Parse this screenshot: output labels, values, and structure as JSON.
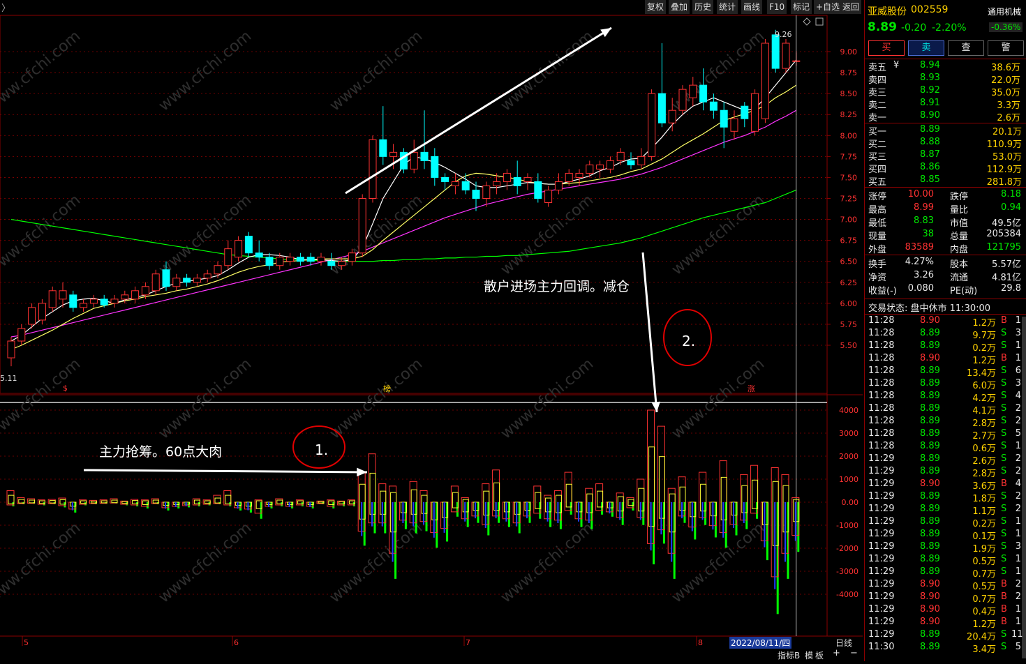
{
  "toolbar": {
    "back_arrow": "〉",
    "items": [
      "复权",
      "叠加",
      "历史",
      "统计",
      "画线",
      "F10",
      "标记",
      "+自选",
      "返回"
    ]
  },
  "price_axis": {
    "labels": [
      "9.00",
      "8.75",
      "8.50",
      "8.25",
      "8.00",
      "7.75",
      "7.50",
      "7.25",
      "7.00",
      "6.75",
      "6.50",
      "6.25",
      "6.00",
      "5.75",
      "5.50"
    ],
    "high_label": "9.26",
    "low_label": "5.11"
  },
  "volume_axis": {
    "labels": [
      "4000",
      "3000",
      "2000",
      "1000",
      "0.00",
      "-1000",
      "-2000",
      "-3000",
      "-4000"
    ]
  },
  "date_axis": {
    "labels": [
      "5",
      "6",
      "7",
      "8"
    ],
    "current_date": "2022/08/11/四",
    "period": "日线"
  },
  "markers": {
    "m1": "$",
    "m2": "榜",
    "m3": "涨"
  },
  "annotations": {
    "text_top": "散户进场主力回调。减仓",
    "text_bottom": "主力抢筹。60点大肉",
    "circle1": "1.",
    "circle2": "2."
  },
  "bottom_bar": {
    "indicator": "指标B",
    "template": "模",
    "board": "板",
    "plus": "+",
    "minus": "−"
  },
  "watermark": "www.cfchi.com",
  "stock": {
    "name": "亚威股份",
    "code": "002559",
    "sector": "通用机械",
    "sector_change": "-0.36%",
    "price": "8.89",
    "change": "-0.20",
    "change_pct": "-2.20%"
  },
  "trade_buttons": [
    "买",
    "卖",
    "查",
    "警"
  ],
  "order_book": {
    "asks": [
      {
        "label": "卖五",
        "price": "8.94",
        "vol": "38.6万",
        "mark": "¥"
      },
      {
        "label": "卖四",
        "price": "8.93",
        "vol": "22.0万",
        "mark": ""
      },
      {
        "label": "卖三",
        "price": "8.92",
        "vol": "35.0万",
        "mark": ""
      },
      {
        "label": "卖二",
        "price": "8.91",
        "vol": "3.3万",
        "mark": ""
      },
      {
        "label": "卖一",
        "price": "8.90",
        "vol": "2.6万",
        "mark": ""
      }
    ],
    "bids": [
      {
        "label": "买一",
        "price": "8.89",
        "vol": "20.1万"
      },
      {
        "label": "买二",
        "price": "8.88",
        "vol": "110.9万"
      },
      {
        "label": "买三",
        "price": "8.87",
        "vol": "53.0万"
      },
      {
        "label": "买四",
        "price": "8.86",
        "vol": "112.9万"
      },
      {
        "label": "买五",
        "price": "8.85",
        "vol": "281.8万"
      }
    ]
  },
  "stats": [
    {
      "l1": "涨停",
      "v1": "10.00",
      "c1": "red",
      "l2": "跌停",
      "v2": "8.18",
      "c2": "green"
    },
    {
      "l1": "最高",
      "v1": "8.99",
      "c1": "red",
      "l2": "量比",
      "v2": "0.94",
      "c2": "green"
    },
    {
      "l1": "最低",
      "v1": "8.83",
      "c1": "green",
      "l2": "市值",
      "v2": "49.5亿",
      "c2": "white"
    },
    {
      "l1": "现量",
      "v1": "38",
      "c1": "green",
      "l2": "总量",
      "v2": "205384",
      "c2": "white"
    },
    {
      "l1": "外盘",
      "v1": "83589",
      "c1": "red",
      "l2": "内盘",
      "v2": "121795",
      "c2": "green"
    }
  ],
  "stats2": [
    {
      "l1": "换手",
      "v1": "4.27%",
      "l2": "股本",
      "v2": "5.57亿"
    },
    {
      "l1": "净资",
      "v1": "3.26",
      "l2": "流通",
      "v2": "4.81亿"
    },
    {
      "l1": "收益(-)",
      "v1": "0.080",
      "l2": "PE(动)",
      "v2": "29.8"
    }
  ],
  "trade_status": "交易状态: 盘中休市 11:30:00",
  "ticks": [
    {
      "t": "11:28",
      "p": "8.90",
      "v": "1.2万",
      "d": "B",
      "n": "1"
    },
    {
      "t": "11:28",
      "p": "8.89",
      "v": "9.7万",
      "d": "S",
      "n": "3"
    },
    {
      "t": "11:28",
      "p": "8.89",
      "v": "0.2万",
      "d": "S",
      "n": "1"
    },
    {
      "t": "11:28",
      "p": "8.90",
      "v": "1.2万",
      "d": "B",
      "n": "1"
    },
    {
      "t": "11:28",
      "p": "8.89",
      "v": "13.4万",
      "d": "S",
      "n": "6"
    },
    {
      "t": "11:28",
      "p": "8.89",
      "v": "6.0万",
      "d": "S",
      "n": "3"
    },
    {
      "t": "11:28",
      "p": "8.89",
      "v": "4.2万",
      "d": "S",
      "n": "4"
    },
    {
      "t": "11:28",
      "p": "8.89",
      "v": "4.1万",
      "d": "S",
      "n": "2"
    },
    {
      "t": "11:28",
      "p": "8.89",
      "v": "2.8万",
      "d": "S",
      "n": "2"
    },
    {
      "t": "11:28",
      "p": "8.89",
      "v": "2.7万",
      "d": "S",
      "n": "5"
    },
    {
      "t": "11:28",
      "p": "8.89",
      "v": "0.6万",
      "d": "S",
      "n": "1"
    },
    {
      "t": "11:29",
      "p": "8.89",
      "v": "2.6万",
      "d": "S",
      "n": "2"
    },
    {
      "t": "11:29",
      "p": "8.89",
      "v": "2.8万",
      "d": "S",
      "n": "2"
    },
    {
      "t": "11:29",
      "p": "8.90",
      "v": "3.6万",
      "d": "B",
      "n": "4"
    },
    {
      "t": "11:29",
      "p": "8.89",
      "v": "1.8万",
      "d": "S",
      "n": "2"
    },
    {
      "t": "11:29",
      "p": "8.89",
      "v": "1.1万",
      "d": "S",
      "n": "2"
    },
    {
      "t": "11:29",
      "p": "8.89",
      "v": "0.2万",
      "d": "S",
      "n": "1"
    },
    {
      "t": "11:29",
      "p": "8.89",
      "v": "0.1万",
      "d": "S",
      "n": "1"
    },
    {
      "t": "11:29",
      "p": "8.89",
      "v": "1.9万",
      "d": "S",
      "n": "3"
    },
    {
      "t": "11:29",
      "p": "8.89",
      "v": "0.5万",
      "d": "S",
      "n": "1"
    },
    {
      "t": "11:29",
      "p": "8.89",
      "v": "0.7万",
      "d": "S",
      "n": "1"
    },
    {
      "t": "11:29",
      "p": "8.90",
      "v": "0.5万",
      "d": "B",
      "n": "2"
    },
    {
      "t": "11:29",
      "p": "8.90",
      "v": "0.7万",
      "d": "B",
      "n": "2"
    },
    {
      "t": "11:29",
      "p": "8.90",
      "v": "0.4万",
      "d": "B",
      "n": "1"
    },
    {
      "t": "11:29",
      "p": "8.90",
      "v": "1.2万",
      "d": "B",
      "n": "1"
    },
    {
      "t": "11:29",
      "p": "8.89",
      "v": "20.4万",
      "d": "S",
      "n": "11"
    },
    {
      "t": "11:30",
      "p": "8.89",
      "v": "3.4万",
      "d": "S",
      "n": "5"
    }
  ],
  "colors": {
    "up": "#ff3232",
    "down": "#00ffff",
    "ma5": "#ffffff",
    "ma10": "#ffff66",
    "ma20": "#ff33ff",
    "ma60": "#00ff00"
  },
  "chart_data": {
    "type": "candlestick",
    "price_range": [
      5.11,
      9.26
    ],
    "candles": [
      [
        5.35,
        5.55,
        5.25,
        5.6
      ],
      [
        5.55,
        5.7,
        5.5,
        5.75
      ],
      [
        5.75,
        5.95,
        5.7,
        6.0
      ],
      [
        5.8,
        6.0,
        5.75,
        6.05
      ],
      [
        5.95,
        6.15,
        5.9,
        6.2
      ],
      [
        6.05,
        6.15,
        5.95,
        6.25
      ],
      [
        6.1,
        5.95,
        5.9,
        6.15
      ],
      [
        5.95,
        6.0,
        5.9,
        6.05
      ],
      [
        6.0,
        6.05,
        5.95,
        6.1
      ],
      [
        6.05,
        5.98,
        5.95,
        6.1
      ],
      [
        6.0,
        6.05,
        5.95,
        6.1
      ],
      [
        6.05,
        6.1,
        6.0,
        6.15
      ],
      [
        6.05,
        6.15,
        6.0,
        6.2
      ],
      [
        6.1,
        6.2,
        6.05,
        6.25
      ],
      [
        6.15,
        6.35,
        6.1,
        6.4
      ],
      [
        6.4,
        6.2,
        6.15,
        6.5
      ],
      [
        6.2,
        6.3,
        6.15,
        6.35
      ],
      [
        6.3,
        6.25,
        6.2,
        6.35
      ],
      [
        6.25,
        6.3,
        6.2,
        6.35
      ],
      [
        6.3,
        6.35,
        6.25,
        6.4
      ],
      [
        6.35,
        6.45,
        6.3,
        6.5
      ],
      [
        6.45,
        6.65,
        6.4,
        6.75
      ],
      [
        6.55,
        6.75,
        6.5,
        6.8
      ],
      [
        6.8,
        6.6,
        6.55,
        6.85
      ],
      [
        6.6,
        6.55,
        6.5,
        6.75
      ],
      [
        6.55,
        6.45,
        6.4,
        6.6
      ],
      [
        6.45,
        6.55,
        6.4,
        6.6
      ],
      [
        6.5,
        6.55,
        6.45,
        6.6
      ],
      [
        6.55,
        6.5,
        6.45,
        6.6
      ],
      [
        6.55,
        6.5,
        6.45,
        6.6
      ],
      [
        6.5,
        6.55,
        6.45,
        6.6
      ],
      [
        6.5,
        6.45,
        6.4,
        6.6
      ],
      [
        6.45,
        6.5,
        6.4,
        6.55
      ],
      [
        6.5,
        6.6,
        6.45,
        6.65
      ],
      [
        6.6,
        7.25,
        6.55,
        7.3
      ],
      [
        7.25,
        7.95,
        7.2,
        8.0
      ],
      [
        7.95,
        7.75,
        7.65,
        8.35
      ],
      [
        7.75,
        7.8,
        7.6,
        7.9
      ],
      [
        7.8,
        7.6,
        7.55,
        7.85
      ],
      [
        7.6,
        7.8,
        7.55,
        7.95
      ],
      [
        7.8,
        7.7,
        7.6,
        8.3
      ],
      [
        7.75,
        7.5,
        7.4,
        7.85
      ],
      [
        7.5,
        7.45,
        7.35,
        7.55
      ],
      [
        7.4,
        7.45,
        7.3,
        7.55
      ],
      [
        7.45,
        7.35,
        7.3,
        7.55
      ],
      [
        7.35,
        7.25,
        7.1,
        7.45
      ],
      [
        7.25,
        7.4,
        7.15,
        7.45
      ],
      [
        7.4,
        7.45,
        7.3,
        7.55
      ],
      [
        7.45,
        7.55,
        7.35,
        7.6
      ],
      [
        7.5,
        7.4,
        7.3,
        7.7
      ],
      [
        7.45,
        7.5,
        7.35,
        7.55
      ],
      [
        7.45,
        7.25,
        7.2,
        7.55
      ],
      [
        7.2,
        7.35,
        7.15,
        7.4
      ],
      [
        7.35,
        7.45,
        7.3,
        7.55
      ],
      [
        7.45,
        7.55,
        7.4,
        7.6
      ],
      [
        7.5,
        7.55,
        7.4,
        7.6
      ],
      [
        7.55,
        7.65,
        7.5,
        7.7
      ],
      [
        7.6,
        7.65,
        7.5,
        7.7
      ],
      [
        7.6,
        7.7,
        7.55,
        7.75
      ],
      [
        7.7,
        7.8,
        7.65,
        7.85
      ],
      [
        7.7,
        7.65,
        7.6,
        7.8
      ],
      [
        7.65,
        7.75,
        7.6,
        7.85
      ],
      [
        7.75,
        8.5,
        7.7,
        8.55
      ],
      [
        8.5,
        8.15,
        8.1,
        9.1
      ],
      [
        8.15,
        8.3,
        8.05,
        8.45
      ],
      [
        8.3,
        8.55,
        8.25,
        8.6
      ],
      [
        8.45,
        8.6,
        8.35,
        8.7
      ],
      [
        8.6,
        8.4,
        8.3,
        8.8
      ],
      [
        8.4,
        8.3,
        8.2,
        8.5
      ],
      [
        8.3,
        8.1,
        7.85,
        8.4
      ],
      [
        8.05,
        8.2,
        7.95,
        8.3
      ],
      [
        8.35,
        8.2,
        8.1,
        8.4
      ],
      [
        8.05,
        8.5,
        8.0,
        8.55
      ],
      [
        8.2,
        9.1,
        8.15,
        9.15
      ],
      [
        9.2,
        8.8,
        8.75,
        9.26
      ],
      [
        8.8,
        9.1,
        8.75,
        9.15
      ],
      [
        8.89,
        8.89,
        8.83,
        8.99
      ]
    ],
    "ma5": [
      5.55,
      5.62,
      5.72,
      5.82,
      5.9,
      5.98,
      6.03,
      6.05,
      6.06,
      6.03,
      6.0,
      6.04,
      6.07,
      6.1,
      6.15,
      6.2,
      6.24,
      6.26,
      6.28,
      6.3,
      6.33,
      6.4,
      6.48,
      6.55,
      6.58,
      6.58,
      6.57,
      6.55,
      6.52,
      6.52,
      6.52,
      6.51,
      6.5,
      6.52,
      6.66,
      6.95,
      7.25,
      7.45,
      7.65,
      7.75,
      7.72,
      7.68,
      7.62,
      7.55,
      7.48,
      7.4,
      7.38,
      7.38,
      7.4,
      7.42,
      7.44,
      7.43,
      7.42,
      7.42,
      7.45,
      7.48,
      7.52,
      7.58,
      7.62,
      7.68,
      7.72,
      7.73,
      7.85,
      7.98,
      8.13,
      8.25,
      8.35,
      8.4,
      8.45,
      8.4,
      8.35,
      8.3,
      8.32,
      8.45,
      8.6,
      8.75,
      8.9
    ],
    "ma10": [
      5.45,
      5.5,
      5.56,
      5.62,
      5.68,
      5.75,
      5.82,
      5.88,
      5.94,
      5.97,
      6.0,
      6.03,
      6.05,
      6.08,
      6.1,
      6.12,
      6.15,
      6.17,
      6.2,
      6.23,
      6.27,
      6.32,
      6.37,
      6.41,
      6.44,
      6.46,
      6.49,
      6.5,
      6.51,
      6.52,
      6.53,
      6.53,
      6.53,
      6.53,
      6.56,
      6.64,
      6.75,
      6.85,
      6.95,
      7.05,
      7.15,
      7.25,
      7.35,
      7.45,
      7.52,
      7.55,
      7.54,
      7.52,
      7.5,
      7.48,
      7.45,
      7.43,
      7.42,
      7.42,
      7.43,
      7.44,
      7.46,
      7.48,
      7.5,
      7.53,
      7.57,
      7.6,
      7.66,
      7.72,
      7.8,
      7.88,
      7.95,
      8.02,
      8.1,
      8.18,
      8.22,
      8.26,
      8.3,
      8.36,
      8.45,
      8.52,
      8.6
    ],
    "ma20": [
      5.6,
      5.62,
      5.65,
      5.68,
      5.71,
      5.74,
      5.77,
      5.8,
      5.83,
      5.86,
      5.89,
      5.92,
      5.95,
      5.98,
      6.01,
      6.04,
      6.07,
      6.1,
      6.13,
      6.16,
      6.19,
      6.22,
      6.25,
      6.28,
      6.31,
      6.34,
      6.37,
      6.4,
      6.43,
      6.46,
      6.49,
      6.52,
      6.55,
      6.58,
      6.62,
      6.67,
      6.72,
      6.77,
      6.82,
      6.87,
      6.92,
      6.97,
      7.02,
      7.06,
      7.1,
      7.14,
      7.18,
      7.21,
      7.24,
      7.27,
      7.3,
      7.32,
      7.34,
      7.36,
      7.38,
      7.4,
      7.42,
      7.44,
      7.46,
      7.48,
      7.51,
      7.54,
      7.58,
      7.62,
      7.67,
      7.72,
      7.77,
      7.82,
      7.87,
      7.92,
      7.96,
      8.0,
      8.05,
      8.1,
      8.17,
      8.23,
      8.3
    ],
    "ma60": [
      7.0,
      6.98,
      6.96,
      6.94,
      6.92,
      6.9,
      6.88,
      6.86,
      6.84,
      6.82,
      6.8,
      6.78,
      6.76,
      6.74,
      6.72,
      6.7,
      6.68,
      6.66,
      6.64,
      6.62,
      6.6,
      6.58,
      6.57,
      6.56,
      6.55,
      6.54,
      6.53,
      6.52,
      6.52,
      6.51,
      6.51,
      6.5,
      6.5,
      6.5,
      6.5,
      6.5,
      6.51,
      6.51,
      6.52,
      6.52,
      6.53,
      6.53,
      6.54,
      6.54,
      6.55,
      6.55,
      6.56,
      6.56,
      6.57,
      6.57,
      6.58,
      6.59,
      6.6,
      6.61,
      6.62,
      6.64,
      6.66,
      6.68,
      6.7,
      6.72,
      6.75,
      6.78,
      6.82,
      6.86,
      6.9,
      6.94,
      6.98,
      7.02,
      7.05,
      7.08,
      7.11,
      7.14,
      7.17,
      7.2,
      7.25,
      7.3,
      7.35
    ],
    "indicator_range": [
      -4800,
      4000
    ],
    "indicator": [
      [
        500,
        -200
      ],
      [
        200,
        -100
      ],
      [
        150,
        -80
      ],
      [
        100,
        -150
      ],
      [
        120,
        -100
      ],
      [
        180,
        -250
      ],
      [
        -200,
        -500
      ],
      [
        100,
        -150
      ],
      [
        80,
        -100
      ],
      [
        100,
        -80
      ],
      [
        150,
        -60
      ],
      [
        50,
        -150
      ],
      [
        120,
        -200
      ],
      [
        100,
        -300
      ],
      [
        150,
        -100
      ],
      [
        -100,
        -400
      ],
      [
        -150,
        -300
      ],
      [
        -100,
        -250
      ],
      [
        150,
        -200
      ],
      [
        100,
        -150
      ],
      [
        300,
        -100
      ],
      [
        500,
        -200
      ],
      [
        -200,
        -400
      ],
      [
        -300,
        -500
      ],
      [
        100,
        -800
      ],
      [
        -100,
        -300
      ],
      [
        150,
        -200
      ],
      [
        -100,
        -300
      ],
      [
        100,
        -200
      ],
      [
        -150,
        -300
      ],
      [
        50,
        -100
      ],
      [
        100,
        -300
      ],
      [
        50,
        -200
      ],
      [
        100,
        -200
      ],
      [
        1300,
        -2100
      ],
      [
        2100,
        -1500
      ],
      [
        800,
        -1500
      ],
      [
        700,
        -3700
      ],
      [
        -200,
        -1300
      ],
      [
        900,
        -1500
      ],
      [
        500,
        -1400
      ],
      [
        -800,
        -2200
      ],
      [
        -300,
        -1900
      ],
      [
        700,
        -700
      ],
      [
        200,
        -1200
      ],
      [
        -200,
        -1000
      ],
      [
        800,
        -1600
      ],
      [
        1400,
        -1000
      ],
      [
        -100,
        -1200
      ],
      [
        -200,
        -1500
      ],
      [
        -300,
        -1000
      ],
      [
        700,
        -800
      ],
      [
        300,
        -1200
      ],
      [
        500,
        -1300
      ],
      [
        1300,
        -600
      ],
      [
        -200,
        -1200
      ],
      [
        600,
        -1300
      ],
      [
        800,
        -600
      ],
      [
        -200,
        -700
      ],
      [
        400,
        -1100
      ],
      [
        200,
        -400
      ],
      [
        1000,
        -1100
      ],
      [
        4000,
        -3000
      ],
      [
        3300,
        -2000
      ],
      [
        600,
        -3700
      ],
      [
        1100,
        -1000
      ],
      [
        -200,
        -1800
      ],
      [
        1300,
        -1100
      ],
      [
        -300,
        -1700
      ],
      [
        1800,
        -2200
      ],
      [
        -300,
        -1600
      ],
      [
        1200,
        -1300
      ],
      [
        1600,
        -800
      ],
      [
        -500,
        -2800
      ],
      [
        1500,
        -5400
      ],
      [
        1200,
        -3700
      ],
      [
        200,
        -2400
      ]
    ]
  }
}
